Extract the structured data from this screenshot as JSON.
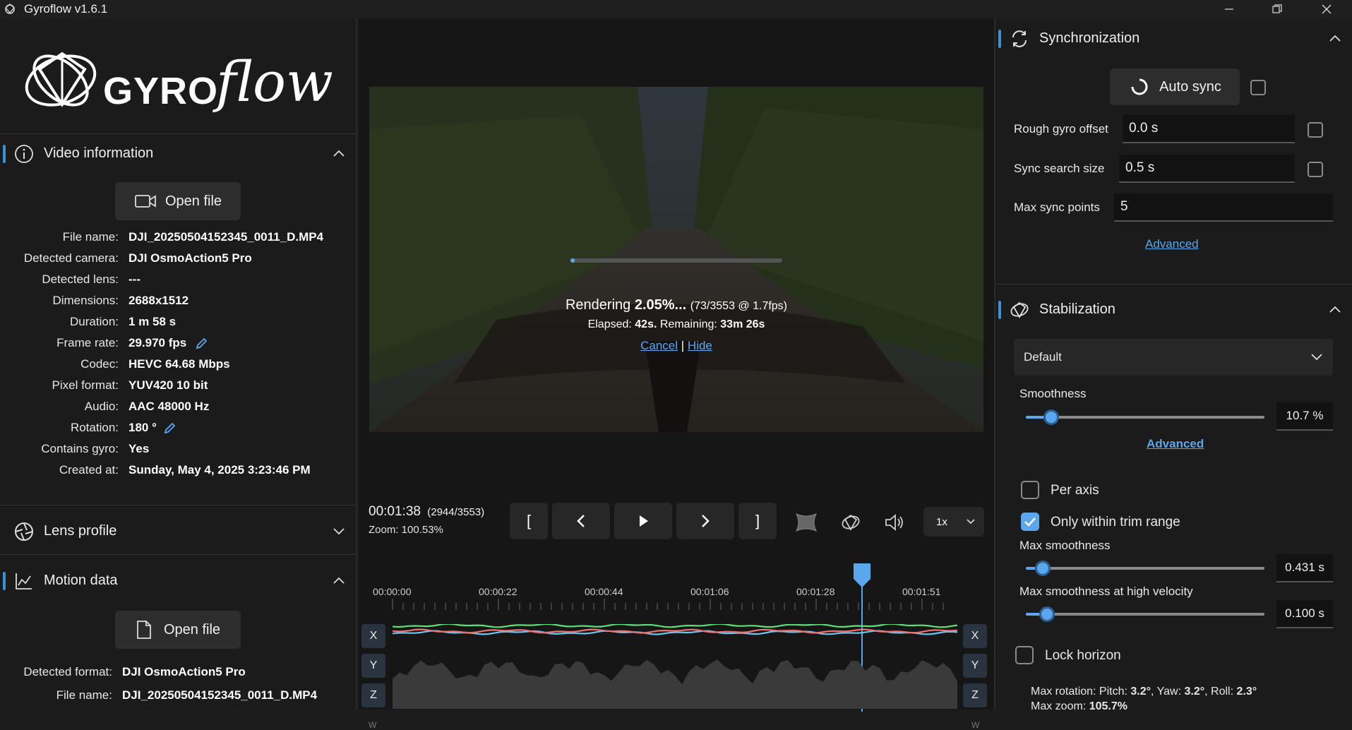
{
  "window": {
    "title": "Gyroflow v1.6.1"
  },
  "left": {
    "logo_text": "GYRO",
    "logo_script": "flow",
    "video_info": {
      "title": "Video information",
      "open_file": "Open file",
      "rows": [
        {
          "k": "File name:",
          "v": "DJI_20250504152345_0011_D.MP4"
        },
        {
          "k": "Detected camera:",
          "v": "DJI OsmoAction5 Pro"
        },
        {
          "k": "Detected lens:",
          "v": "---"
        },
        {
          "k": "Dimensions:",
          "v": "2688x1512"
        },
        {
          "k": "Duration:",
          "v": "1 m 58 s"
        },
        {
          "k": "Frame rate:",
          "v": "29.970 fps"
        },
        {
          "k": "Codec:",
          "v": "HEVC 64.68 Mbps"
        },
        {
          "k": "Pixel format:",
          "v": "YUV420 10 bit"
        },
        {
          "k": "Audio:",
          "v": "AAC 48000 Hz"
        },
        {
          "k": "Rotation:",
          "v": "180 °"
        },
        {
          "k": "Contains gyro:",
          "v": "Yes"
        },
        {
          "k": "Created at:",
          "v": "Sunday, May 4, 2025 3:23:46 PM"
        }
      ]
    },
    "lens_profile": {
      "title": "Lens profile"
    },
    "motion_data": {
      "title": "Motion data",
      "open_file": "Open file",
      "rows": [
        {
          "k": "Detected format:",
          "v": "DJI OsmoAction5 Pro"
        },
        {
          "k": "File name:",
          "v": "DJI_20250504152345_0011_D.MP4"
        }
      ]
    }
  },
  "center": {
    "render": {
      "label": "Rendering",
      "percent": "2.05%...",
      "detail": "(73/3553 @ 1.7fps)",
      "elapsed_label": "Elapsed:",
      "elapsed": "42s.",
      "remaining_label": "Remaining:",
      "remaining": "33m 26s",
      "cancel": "Cancel",
      "sep": "|",
      "hide": "Hide",
      "progress": 0.0205
    },
    "playback": {
      "time": "00:01:38",
      "frame": "(2944/3553)",
      "zoom": "Zoom: 100.53%",
      "trim_start": "[",
      "trim_end": "]",
      "speed": "1x"
    },
    "timeline": {
      "ticks": [
        "00:00:00",
        "00:00:22",
        "00:00:44",
        "00:01:06",
        "00:01:28",
        "00:01:51"
      ],
      "axes_left": [
        "X",
        "Y",
        "Z"
      ],
      "axes_right": [
        "X",
        "Y",
        "Z"
      ],
      "bottom_left": "W",
      "bottom_right": "W"
    }
  },
  "right": {
    "sync": {
      "title": "Synchronization",
      "auto_sync": "Auto sync",
      "rough_offset_label": "Rough gyro offset",
      "rough_offset": "0.0 s",
      "search_size_label": "Sync search size",
      "search_size": "0.5 s",
      "max_points_label": "Max sync points",
      "max_points": "5",
      "advanced": "Advanced"
    },
    "stab": {
      "title": "Stabilization",
      "method": "Default",
      "smoothness_label": "Smoothness",
      "smoothness": "10.7 %",
      "smoothness_level": 0.107,
      "advanced": "Advanced",
      "per_axis": "Per axis",
      "trim_only": "Only within trim range",
      "max_smooth_label": "Max smoothness",
      "max_smooth": "0.431 s",
      "max_smooth_level": 0.07,
      "max_smooth_hv_label": "Max smoothness at high velocity",
      "max_smooth_hv": "0.100 s",
      "max_smooth_hv_level": 0.09,
      "lock_horizon": "Lock horizon",
      "max_rotation_label": "Max rotation: Pitch:",
      "pitch": "3.2°",
      "yaw_label": ", Yaw:",
      "yaw": "3.2°",
      "roll_label": ", Roll:",
      "roll": "2.3°",
      "max_zoom_label": "Max zoom:",
      "max_zoom": "105.7%"
    }
  },
  "colors": {
    "accent": "#5aa7ee",
    "bar": "#3d8fd6",
    "green": "#5ee07a",
    "red": "#f07070",
    "cyan": "#6ac8f0"
  },
  "icons": [
    "gyroflow-logo-icon",
    "info-icon",
    "video-camera-icon",
    "pencil-icon",
    "lens-icon",
    "chart-icon",
    "file-icon",
    "sync-icon",
    "play-icon",
    "volume-icon",
    "chevron-down-icon",
    "chevron-up-icon"
  ]
}
